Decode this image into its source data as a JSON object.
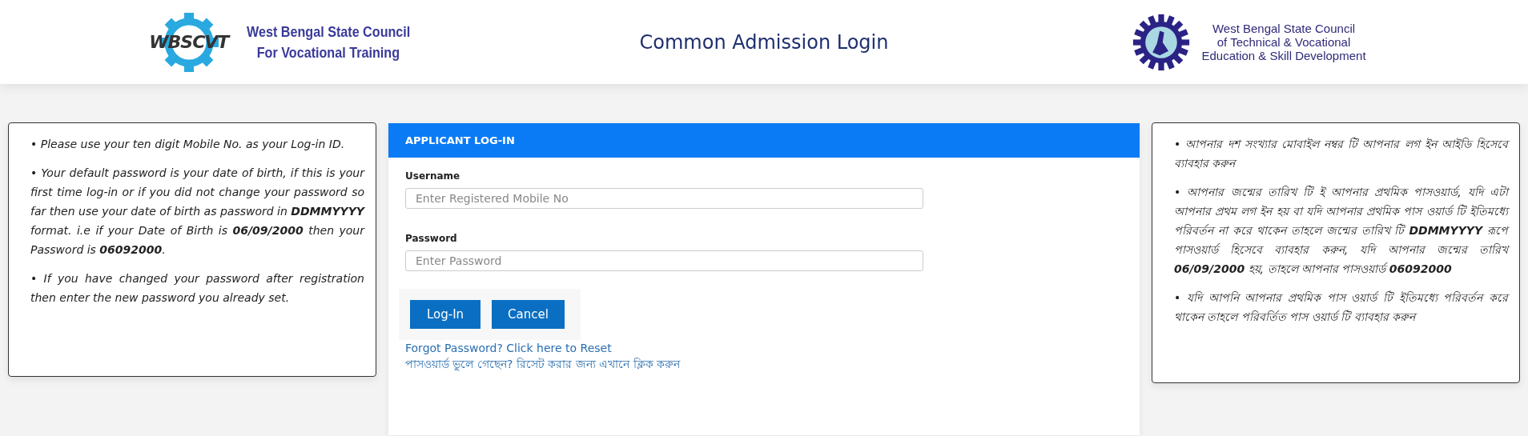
{
  "header": {
    "left_logo": {
      "mark": "WBSCVT",
      "lines": [
        "West Bengal State Council",
        "For Vocational Training"
      ]
    },
    "title": "Common Admission Login",
    "right_logo": {
      "lines": [
        "West Bengal State Council",
        "of Technical & Vocational",
        "Education & Skill Development"
      ]
    }
  },
  "left_notes": [
    "• Please use your ten digit Mobile No. as your Log-in ID.",
    "• Your default password is your date of birth, if this is your first time log-in or if you did not change your password so far then use your date of birth as password in **DDMMYYYY** format. i.e if your Date of Birth is **06/09/2000** then your Password is **06092000**.",
    "• If you have changed your password after registration then enter the new password you already set."
  ],
  "login": {
    "heading": "APPLICANT LOG-IN",
    "fields": [
      {
        "label": "Username",
        "placeholder": "Enter Registered Mobile No"
      },
      {
        "label": "Password",
        "placeholder": "Enter Password"
      }
    ],
    "buttons": [
      "Log-In",
      "Cancel"
    ],
    "links": [
      "Forgot Password? Click here to Reset",
      "পাসওয়ার্ড ভুলে গেছেন? রিসেট করার জন্য এখানে ক্লিক করুন"
    ]
  },
  "right_notes": [
    "• আপনার দশ সংখ্যার মোবাইল নম্বর টি আপনার লগ ইন আইডি হিসেবে ব্যাবহার করুন",
    "• আপনার জন্মের তারিখ টি ই আপনার প্রথমিক পাসওয়ার্ড, যদি এটা আপনার প্রথম লগ ইন হয় বা যদি আপনার প্রথমিক পাস ওয়ার্ড টি ইতিমধ্যে পরিবর্তন না করে থাকেন তাহলে জন্মের তারিখ টি **DDMMYYYY** রূপে পাসওয়ার্ড হিসেবে ব্যাবহার করুন, যদি আপনার জন্মের তারিখ **06/09/2000** হয়, তাহলে আপনার পাসওয়ার্ড **06092000**",
    "• যদি আপনি আপনার প্রথমিক পাস ওয়ার্ড টি ইতিমধ্যে পরিবর্তন করে থাকেন তাহলে পরিবর্তিত পাস ওয়ার্ড টি ব্যাবহার করুন"
  ]
}
